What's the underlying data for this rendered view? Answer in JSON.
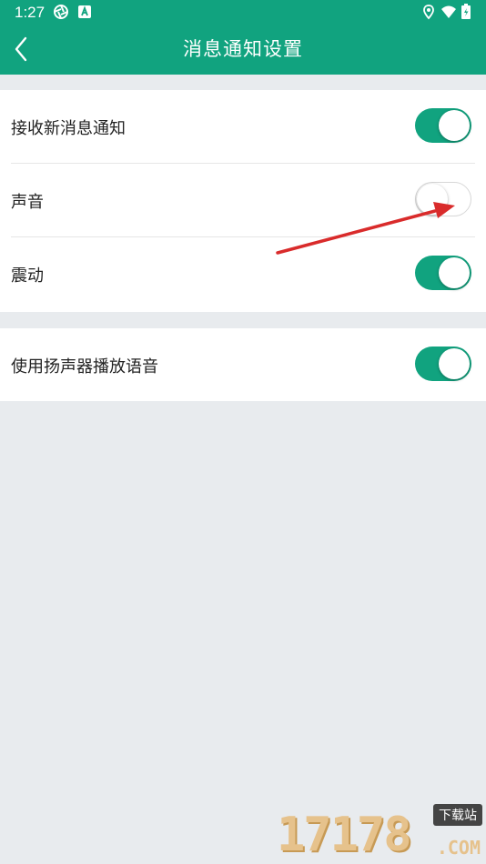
{
  "status_bar": {
    "time": "1:27",
    "icons": [
      "aperture-icon",
      "a-box-icon",
      "location-pin-icon",
      "wifi-icon",
      "battery-icon"
    ]
  },
  "header": {
    "title": "消息通知设置",
    "back_icon": "chevron-left-icon"
  },
  "settings": {
    "group1": [
      {
        "label": "接收新消息通知",
        "enabled": true
      },
      {
        "label": "声音",
        "enabled": false
      },
      {
        "label": "震动",
        "enabled": true
      }
    ],
    "group2": [
      {
        "label": "使用扬声器播放语音",
        "enabled": true
      }
    ]
  },
  "annotation": {
    "color": "#d92b2b"
  },
  "watermark": {
    "number": "17178",
    "tag": "下载站",
    "domain": ".COM"
  },
  "colors": {
    "accent": "#11a37f",
    "background": "#e8ebee"
  }
}
